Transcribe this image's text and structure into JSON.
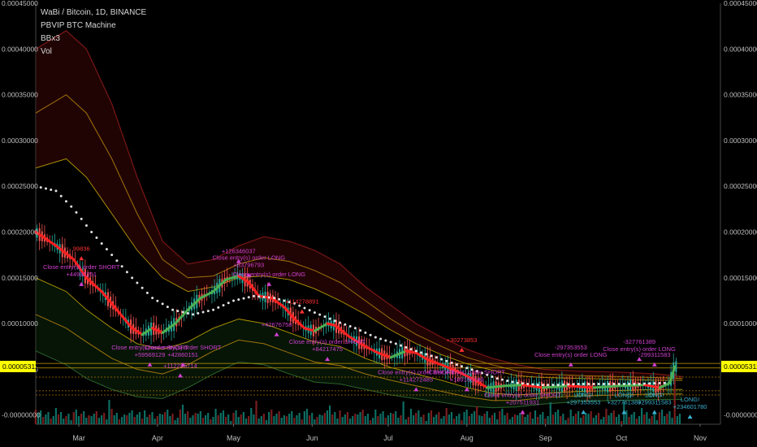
{
  "legend": {
    "title": "WaBi / Bitcoin, 1D, BINANCE",
    "indicators": [
      "PBVIP BTC Machine",
      "BBx3",
      "Vol"
    ]
  },
  "price_marker": {
    "label": "0.00005312",
    "value": 5.312e-05
  },
  "colors": {
    "background": "#000000",
    "axis_text": "#bfbfbf",
    "up_candle": "#26a69a",
    "down_candle": "#ef5350",
    "trend_line_down": "#ff2020",
    "trend_line_up": "#4caf50",
    "moving_average_dots": "#e0e0e0",
    "band_outer": "#8b1a1a",
    "band_mid": "#b8860b",
    "band_inner": "#d4b400",
    "signal_text": "#d040d0",
    "signal_text_red": "#ff3030",
    "long_text": "#3bb0d0",
    "price_marker_bg": "#ffff00"
  },
  "chart_data": {
    "type": "candlestick",
    "symbol": "WaBi / Bitcoin",
    "timeframe": "1D",
    "exchange": "BINANCE",
    "y_ticks": [
      "0.00045000",
      "0.00040000",
      "0.00035000",
      "0.00030000",
      "0.00025000",
      "0.00020000",
      "0.00015000",
      "0.00010000",
      "0.00005000",
      "-0.00000000"
    ],
    "y_tick_values": [
      0.00045,
      0.0004,
      0.00035,
      0.0003,
      0.00025,
      0.0002,
      0.00015,
      0.0001,
      5e-05,
      0.0
    ],
    "x_ticks": [
      "Mar",
      "Apr",
      "May",
      "Jun",
      "Jul",
      "Aug",
      "Sep",
      "Oct",
      "Nov"
    ],
    "x_tick_days": [
      17,
      48,
      78,
      109,
      139,
      170,
      201,
      231,
      262
    ],
    "ylim": [
      -1e-05,
      0.00045
    ],
    "xlim": [
      0,
      270
    ],
    "price_path": [
      [
        0,
        0.0002
      ],
      [
        8,
        0.000185
      ],
      [
        15,
        0.00017
      ],
      [
        20,
        0.00015
      ],
      [
        26,
        0.000135
      ],
      [
        32,
        0.000115
      ],
      [
        38,
        9.5e-05
      ],
      [
        42,
        8.8e-05
      ],
      [
        46,
        9.5e-05
      ],
      [
        50,
        9e-05
      ],
      [
        55,
        0.0001
      ],
      [
        60,
        0.000115
      ],
      [
        65,
        0.000128
      ],
      [
        70,
        0.000135
      ],
      [
        75,
        0.000148
      ],
      [
        80,
        0.000152
      ],
      [
        84,
        0.000145
      ],
      [
        88,
        0.00013
      ],
      [
        93,
        0.000128
      ],
      [
        98,
        0.000118
      ],
      [
        102,
        0.000105
      ],
      [
        106,
        9.5e-05
      ],
      [
        110,
        9.2e-05
      ],
      [
        115,
        0.0001
      ],
      [
        118,
        9.8e-05
      ],
      [
        124,
        8.5e-05
      ],
      [
        130,
        7.5e-05
      ],
      [
        135,
        6.8e-05
      ],
      [
        140,
        6.3e-05
      ],
      [
        146,
        7e-05
      ],
      [
        150,
        6.8e-05
      ],
      [
        155,
        6e-05
      ],
      [
        160,
        5.5e-05
      ],
      [
        166,
        4.8e-05
      ],
      [
        172,
        4e-05
      ],
      [
        178,
        3e-05
      ],
      [
        185,
        3.2e-05
      ],
      [
        192,
        3.3e-05
      ],
      [
        200,
        3e-05
      ],
      [
        210,
        3.2e-05
      ],
      [
        220,
        3e-05
      ],
      [
        230,
        3.2e-05
      ],
      [
        240,
        3.3e-05
      ],
      [
        246,
        3e-05
      ],
      [
        250,
        3.5e-05
      ],
      [
        252,
        5.3e-05
      ]
    ],
    "moving_average": [
      [
        0,
        0.00025
      ],
      [
        8,
        0.000245
      ],
      [
        15,
        0.000225
      ],
      [
        22,
        0.0002
      ],
      [
        30,
        0.000175
      ],
      [
        38,
        0.00015
      ],
      [
        46,
        0.000128
      ],
      [
        54,
        0.000115
      ],
      [
        62,
        0.00011
      ],
      [
        70,
        0.000115
      ],
      [
        78,
        0.000125
      ],
      [
        86,
        0.00013
      ],
      [
        94,
        0.000128
      ],
      [
        102,
        0.000122
      ],
      [
        110,
        0.000112
      ],
      [
        118,
        0.000103
      ],
      [
        126,
        9.5e-05
      ],
      [
        134,
        8.5e-05
      ],
      [
        142,
        7.8e-05
      ],
      [
        150,
        7e-05
      ],
      [
        158,
        6.3e-05
      ],
      [
        166,
        5.5e-05
      ],
      [
        174,
        4.8e-05
      ],
      [
        182,
        4e-05
      ],
      [
        190,
        3.5e-05
      ],
      [
        198,
        3.3e-05
      ],
      [
        206,
        3.3e-05
      ],
      [
        214,
        3.4e-05
      ],
      [
        222,
        3.4e-05
      ],
      [
        230,
        3.4e-05
      ],
      [
        238,
        3.4e-05
      ],
      [
        246,
        3.5e-05
      ]
    ],
    "bands": {
      "upper_outer": [
        [
          0,
          0.0004
        ],
        [
          12,
          0.00042
        ],
        [
          20,
          0.0004
        ],
        [
          30,
          0.00034
        ],
        [
          40,
          0.00026
        ],
        [
          50,
          0.00019
        ],
        [
          60,
          0.000165
        ],
        [
          70,
          0.00017
        ],
        [
          80,
          0.000185
        ],
        [
          90,
          0.000195
        ],
        [
          100,
          0.00019
        ],
        [
          110,
          0.00018
        ],
        [
          120,
          0.000165
        ],
        [
          130,
          0.00014
        ],
        [
          140,
          0.00012
        ],
        [
          150,
          0.0001
        ],
        [
          160,
          8.5e-05
        ],
        [
          170,
          7.2e-05
        ],
        [
          180,
          6.2e-05
        ],
        [
          190,
          5.5e-05
        ],
        [
          200,
          5e-05
        ],
        [
          215,
          4.8e-05
        ],
        [
          230,
          4.7e-05
        ],
        [
          245,
          4.5e-05
        ],
        [
          255,
          4.2e-05
        ]
      ],
      "upper_mid": [
        [
          0,
          0.00033
        ],
        [
          12,
          0.00035
        ],
        [
          20,
          0.00033
        ],
        [
          30,
          0.00028
        ],
        [
          40,
          0.00022
        ],
        [
          50,
          0.00017
        ],
        [
          60,
          0.00015
        ],
        [
          70,
          0.000152
        ],
        [
          80,
          0.000165
        ],
        [
          90,
          0.000172
        ],
        [
          100,
          0.000168
        ],
        [
          110,
          0.000158
        ],
        [
          120,
          0.000145
        ],
        [
          130,
          0.000125
        ],
        [
          140,
          0.000105
        ],
        [
          150,
          8.8e-05
        ],
        [
          160,
          7.5e-05
        ],
        [
          170,
          6.3e-05
        ],
        [
          180,
          5.5e-05
        ],
        [
          190,
          4.8e-05
        ],
        [
          200,
          4.5e-05
        ],
        [
          215,
          4.3e-05
        ],
        [
          230,
          4.2e-05
        ],
        [
          245,
          4.1e-05
        ],
        [
          255,
          4e-05
        ]
      ],
      "upper_inner": [
        [
          0,
          0.00027
        ],
        [
          12,
          0.00028
        ],
        [
          20,
          0.00026
        ],
        [
          30,
          0.00022
        ],
        [
          40,
          0.00018
        ],
        [
          50,
          0.00015
        ],
        [
          60,
          0.000135
        ],
        [
          70,
          0.00014
        ],
        [
          80,
          0.00015
        ],
        [
          90,
          0.000152
        ],
        [
          100,
          0.000148
        ],
        [
          110,
          0.000138
        ],
        [
          120,
          0.000125
        ],
        [
          130,
          0.00011
        ],
        [
          140,
          9.3e-05
        ],
        [
          150,
          7.8e-05
        ],
        [
          160,
          6.6e-05
        ],
        [
          170,
          5.6e-05
        ],
        [
          180,
          4.9e-05
        ],
        [
          190,
          4.3e-05
        ],
        [
          200,
          4.1e-05
        ],
        [
          215,
          4e-05
        ],
        [
          230,
          3.9e-05
        ],
        [
          245,
          3.8e-05
        ],
        [
          255,
          3.8e-05
        ]
      ],
      "lower_inner": [
        [
          0,
          0.00015
        ],
        [
          12,
          0.000135
        ],
        [
          20,
          0.000115
        ],
        [
          30,
          9.5e-05
        ],
        [
          40,
          7.8e-05
        ],
        [
          50,
          7.2e-05
        ],
        [
          60,
          8e-05
        ],
        [
          70,
          9.5e-05
        ],
        [
          80,
          0.000105
        ],
        [
          90,
          0.0001
        ],
        [
          100,
          9e-05
        ],
        [
          110,
          8e-05
        ],
        [
          120,
          7.5e-05
        ],
        [
          130,
          6.2e-05
        ],
        [
          140,
          5.2e-05
        ],
        [
          150,
          4.5e-05
        ],
        [
          160,
          3.8e-05
        ],
        [
          170,
          3e-05
        ],
        [
          180,
          2.4e-05
        ],
        [
          190,
          2.2e-05
        ],
        [
          200,
          2.4e-05
        ],
        [
          215,
          2.6e-05
        ],
        [
          230,
          2.7e-05
        ],
        [
          245,
          2.8e-05
        ],
        [
          255,
          2.8e-05
        ]
      ],
      "lower_mid": [
        [
          0,
          0.00011
        ],
        [
          12,
          9.5e-05
        ],
        [
          20,
          8e-05
        ],
        [
          30,
          6.2e-05
        ],
        [
          40,
          5e-05
        ],
        [
          50,
          4.5e-05
        ],
        [
          60,
          5.5e-05
        ],
        [
          70,
          7e-05
        ],
        [
          80,
          8.2e-05
        ],
        [
          90,
          7.8e-05
        ],
        [
          100,
          6.8e-05
        ],
        [
          110,
          5.8e-05
        ],
        [
          120,
          5.4e-05
        ],
        [
          130,
          4.5e-05
        ],
        [
          140,
          3.8e-05
        ],
        [
          150,
          3.2e-05
        ],
        [
          160,
          2.6e-05
        ],
        [
          170,
          2e-05
        ],
        [
          180,
          1.6e-05
        ],
        [
          190,
          1.6e-05
        ],
        [
          200,
          1.9e-05
        ],
        [
          215,
          2.1e-05
        ],
        [
          230,
          2.2e-05
        ],
        [
          245,
          2.3e-05
        ],
        [
          255,
          2.3e-05
        ]
      ],
      "lower_outer": [
        [
          0,
          7e-05
        ],
        [
          12,
          5.5e-05
        ],
        [
          20,
          4e-05
        ],
        [
          30,
          2.8e-05
        ],
        [
          40,
          2e-05
        ],
        [
          50,
          1.8e-05
        ],
        [
          60,
          3e-05
        ],
        [
          70,
          4.5e-05
        ],
        [
          80,
          5.8e-05
        ],
        [
          90,
          5.5e-05
        ],
        [
          100,
          4.5e-05
        ],
        [
          110,
          3.6e-05
        ],
        [
          120,
          3.4e-05
        ],
        [
          130,
          2.8e-05
        ],
        [
          140,
          2.2e-05
        ],
        [
          150,
          1.8e-05
        ],
        [
          160,
          1.4e-05
        ],
        [
          170,
          1e-05
        ],
        [
          180,
          8e-06
        ],
        [
          190,
          9e-06
        ],
        [
          200,
          1.2e-05
        ],
        [
          215,
          1.5e-05
        ],
        [
          230,
          1.6e-05
        ],
        [
          245,
          1.7e-05
        ],
        [
          255,
          1.7e-05
        ]
      ]
    },
    "horizontal_levels": [
      5.65e-05,
      5.15e-05,
      4.15e-05,
      2.65e-05,
      2.2e-05
    ],
    "signals": [
      {
        "day": 18,
        "value": 0.00015,
        "lines": [
          "Close entry(s) order SHORT",
          "+44992251"
        ],
        "color": "signal_text"
      },
      {
        "day": 18,
        "value": 0.000178,
        "lines": [
          "99836"
        ],
        "color": "signal_text_red"
      },
      {
        "day": 45,
        "value": 6.2e-05,
        "lines": [
          "Close entry(s) order SHORT",
          "+59569129"
        ],
        "color": "signal_text"
      },
      {
        "day": 58,
        "value": 6.2e-05,
        "lines": [
          "Close entry(s) order SHORT",
          "+42860151"
        ],
        "color": "signal_text"
      },
      {
        "day": 57,
        "value": 5e-05,
        "lines": [
          "+112235714"
        ],
        "color": "signal_text"
      },
      {
        "day": 80,
        "value": 0.000175,
        "lines": [
          "+126346037"
        ],
        "color": "signal_text"
      },
      {
        "day": 84,
        "value": 0.00016,
        "lines": [
          "Close entry(s) order LONG",
          "+83796793"
        ],
        "color": "signal_text"
      },
      {
        "day": 92,
        "value": 0.00015,
        "lines": [
          "Close entry(s) order LONG"
        ],
        "color": "signal_text"
      },
      {
        "day": 105,
        "value": 0.00012,
        "lines": [
          "+114278891"
        ],
        "color": "signal_text_red"
      },
      {
        "day": 95,
        "value": 9.5e-05,
        "lines": [
          "+42676758"
        ],
        "color": "signal_text"
      },
      {
        "day": 115,
        "value": 6.8e-05,
        "lines": [
          "Close entry(s) order SHORT",
          "+84217475"
        ],
        "color": "signal_text"
      },
      {
        "day": 168,
        "value": 7.8e-05,
        "lines": [
          "+30273853"
        ],
        "color": "signal_text_red"
      },
      {
        "day": 150,
        "value": 3.5e-05,
        "lines": [
          "Close entry(s) order SHORT",
          "+114272485"
        ],
        "color": "signal_text"
      },
      {
        "day": 170,
        "value": 3.5e-05,
        "lines": [
          "Close entry(s) order SHORT",
          "+189150189"
        ],
        "color": "signal_text"
      },
      {
        "day": 192,
        "value": 1e-05,
        "lines": [
          "Close entry(s) order SHORT",
          "+207511931"
        ],
        "color": "signal_text"
      },
      {
        "day": 211,
        "value": 6.2e-05,
        "lines": [
          "-297353553",
          "Close entry(s) order LONG"
        ],
        "color": "signal_text"
      },
      {
        "day": 238,
        "value": 6.8e-05,
        "lines": [
          "-327761389",
          "Close entry(s) order LONG"
        ],
        "color": "signal_text"
      },
      {
        "day": 244,
        "value": 6.2e-05,
        "lines": [
          "-299311583"
        ],
        "color": "signal_text"
      },
      {
        "day": 216,
        "value": 1e-05,
        "lines": [
          "LONG!",
          "+297353553"
        ],
        "color": "long_text"
      },
      {
        "day": 232,
        "value": 1e-05,
        "lines": [
          "LONG!",
          "+327761389"
        ],
        "color": "long_text"
      },
      {
        "day": 244,
        "value": 1e-05,
        "lines": [
          "LONG!",
          "+299311583"
        ],
        "color": "long_text"
      },
      {
        "day": 258,
        "value": 5e-06,
        "lines": [
          "LONG!",
          "+234601780"
        ],
        "color": "long_text"
      }
    ],
    "volume_max_day": 252
  }
}
